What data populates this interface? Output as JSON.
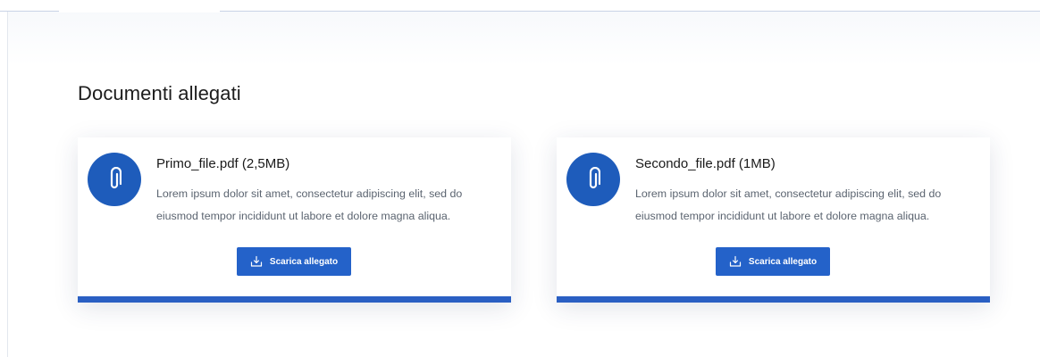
{
  "section": {
    "title": "Documenti allegati"
  },
  "attachments": [
    {
      "file_name": "Primo_file.pdf (2,5MB)",
      "description": "Lorem ipsum dolor sit amet, consectetur adipiscing elit, sed do eiusmod tempor incididunt ut labore et dolore magna aliqua.",
      "button_label": "Scarica allegato",
      "icon": "paperclip-icon"
    },
    {
      "file_name": "Secondo_file.pdf (1MB)",
      "description": "Lorem ipsum dolor sit amet, consectetur adipiscing elit, sed do eiusmod tempor incididunt ut labore et dolore magna aliqua.",
      "button_label": "Scarica allegato",
      "icon": "paperclip-icon"
    }
  ],
  "colors": {
    "primary": "#2462c9",
    "icon_circle": "#1e5cbb",
    "card_bar": "#2a5fc3",
    "text_muted": "#5b6470"
  }
}
